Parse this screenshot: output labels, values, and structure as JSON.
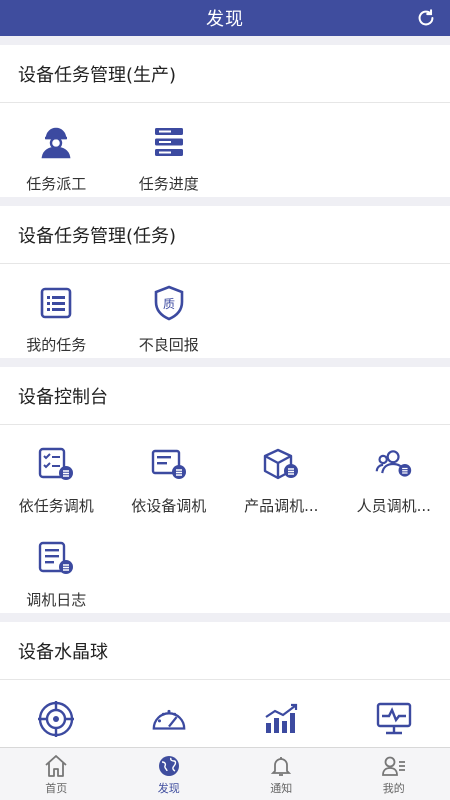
{
  "header": {
    "title": "发现"
  },
  "colors": {
    "primary": "#3f4d9e",
    "icon": "#3c4aa0",
    "background": "#efeff4"
  },
  "sections": [
    {
      "title": "设备任务管理(生产)",
      "items": [
        {
          "label": "任务派工",
          "icon": "worker-icon"
        },
        {
          "label": "任务进度",
          "icon": "stack-icon"
        }
      ]
    },
    {
      "title": "设备任务管理(任务)",
      "items": [
        {
          "label": "我的任务",
          "icon": "list-icon"
        },
        {
          "label": "不良回报",
          "icon": "quality-shield-icon"
        }
      ]
    },
    {
      "title": "设备控制台",
      "items": [
        {
          "label": "依任务调机",
          "icon": "checklist-icon"
        },
        {
          "label": "依设备调机",
          "icon": "device-icon"
        },
        {
          "label": "产品调机...",
          "icon": "box-icon"
        },
        {
          "label": "人员调机...",
          "icon": "people-icon"
        },
        {
          "label": "调机日志",
          "icon": "log-icon"
        }
      ]
    },
    {
      "title": "设备水晶球",
      "items": [
        {
          "icon": "target-icon"
        },
        {
          "icon": "gauge-icon"
        },
        {
          "icon": "bar-chart-icon"
        },
        {
          "icon": "monitor-icon"
        }
      ]
    }
  ],
  "tabbar": [
    {
      "label": "首页",
      "icon": "home-icon",
      "active": false
    },
    {
      "label": "发现",
      "icon": "globe-icon",
      "active": true
    },
    {
      "label": "通知",
      "icon": "bell-icon",
      "active": false
    },
    {
      "label": "我的",
      "icon": "user-icon",
      "active": false
    }
  ]
}
